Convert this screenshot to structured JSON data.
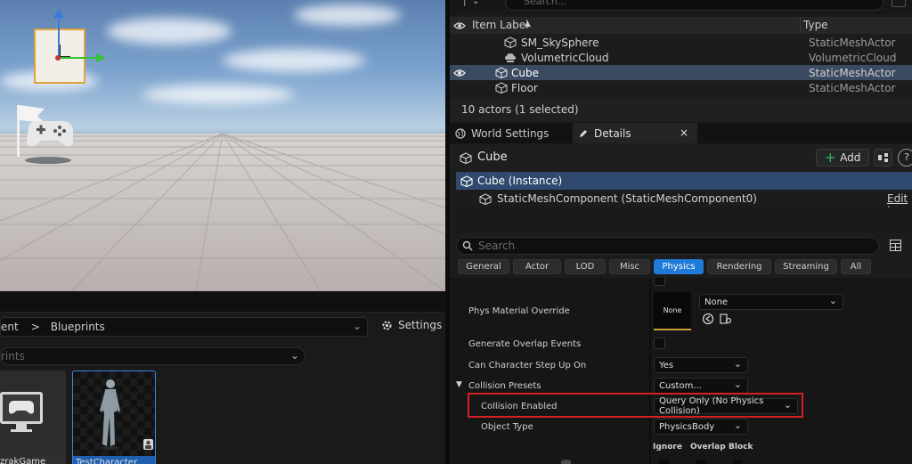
{
  "outliner": {
    "search_placeholder": "Search...",
    "col_item_label": "Item Label",
    "col_type": "Type",
    "rows": [
      {
        "name": "SM_SkySphere",
        "type": "StaticMeshActor"
      },
      {
        "name": "VolumetricCloud",
        "type": "VolumetricCloud"
      },
      {
        "name": "Cube",
        "type": "StaticMeshActor"
      },
      {
        "name": "Floor",
        "type": "StaticMeshActor"
      }
    ],
    "status": "10 actors (1 selected)"
  },
  "tabs": {
    "world_settings": "World Settings",
    "details": "Details",
    "close": "×"
  },
  "details": {
    "actor_name": "Cube",
    "add_label": "Add",
    "help": "?",
    "component_root": "Cube (Instance)",
    "component_child": "StaticMeshComponent (StaticMeshComponent0)",
    "edit_link": "Edit in",
    "search_placeholder": "Search",
    "filters": [
      "General",
      "Actor",
      "LOD",
      "Misc",
      "Physics",
      "Rendering",
      "Streaming",
      "All"
    ],
    "active_filter": "Physics"
  },
  "properties": {
    "phys_material_override": "Phys Material Override",
    "phys_material_thumb": "None",
    "phys_material_value": "None",
    "generate_overlap_events": "Generate Overlap Events",
    "can_character_step_up_on": "Can Character Step Up On",
    "can_character_step_up_on_value": "Yes",
    "collision_presets": "Collision Presets",
    "collision_presets_value": "Custom...",
    "collision_enabled": "Collision Enabled",
    "collision_enabled_value": "Query Only (No Physics Collision)",
    "object_type": "Object Type",
    "object_type_value": "PhysicsBody",
    "col_ignore": "Ignore",
    "col_overlap": "Overlap",
    "col_block": "Block"
  },
  "content_browser": {
    "breadcrumb_prev": "ent",
    "breadcrumb_sep": ">",
    "breadcrumb_current": "Blueprints",
    "settings_label": "Settings",
    "search_placeholder": "rints",
    "assets": [
      {
        "label": "UmzrakGame"
      },
      {
        "label": "TestCharacter"
      }
    ]
  },
  "colors": {
    "accent": "#1f7ad8",
    "selection": "#3a4a60",
    "highlight_box": "#d61f25"
  }
}
